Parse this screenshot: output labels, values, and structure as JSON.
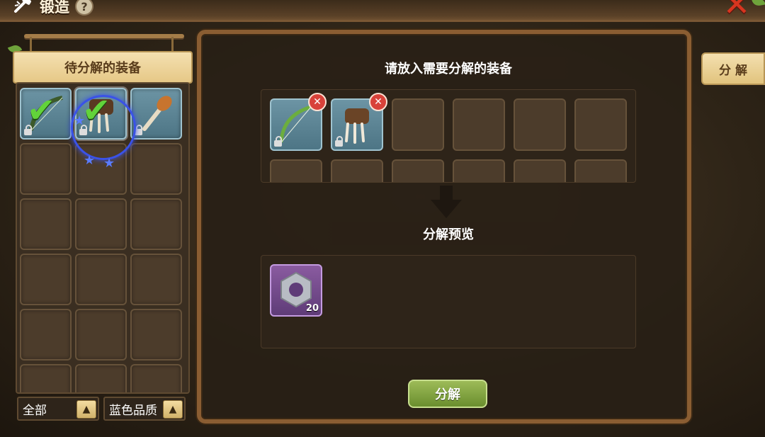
{
  "header": {
    "title": "锻造",
    "help_icon": "question-mark-icon",
    "close_icon": "close-x-icon"
  },
  "left_panel": {
    "banner_label": "待分解的装备",
    "items": [
      {
        "icon": "bow-icon",
        "checked": true,
        "locked": true,
        "quality_color": "#5b8595"
      },
      {
        "icon": "claw-gauntlet-icon",
        "checked": true,
        "locked": true,
        "quality_color": "#5b8595"
      },
      {
        "icon": "wooden-club-icon",
        "checked": false,
        "locked": true,
        "quality_color": "#5b8595"
      }
    ],
    "filter_type": {
      "label": "全部"
    },
    "filter_quality": {
      "label": "蓝色品质"
    }
  },
  "main_panel": {
    "selected_header": "请放入需要分解的装备",
    "selected_items": [
      {
        "icon": "bow-icon",
        "locked": true
      },
      {
        "icon": "claw-gauntlet-icon",
        "locked": true
      }
    ],
    "preview_header": "分解预览",
    "preview_items": [
      {
        "icon": "metal-nut-icon",
        "count": "20",
        "quality_color": "#7a4e94"
      }
    ],
    "decompose_button": "分解"
  },
  "side_tab": {
    "label": "分 解"
  }
}
